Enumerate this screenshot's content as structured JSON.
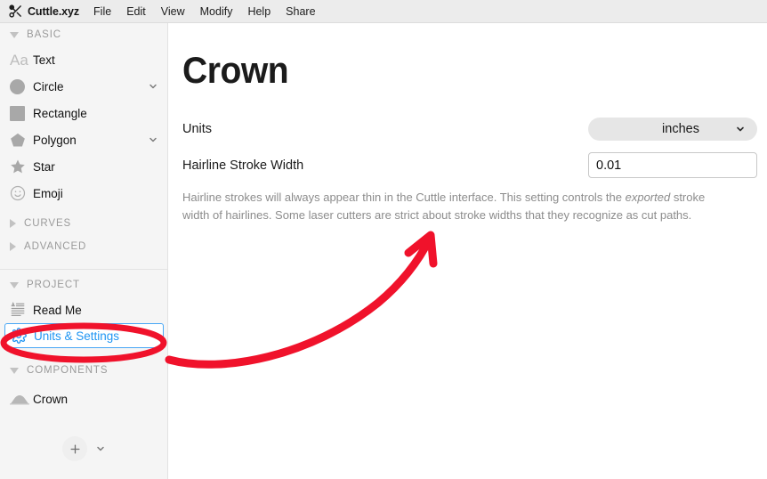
{
  "menubar": {
    "logo_icon": "scissors-icon",
    "app_title": "Cuttle.xyz",
    "items": [
      "File",
      "Edit",
      "View",
      "Modify",
      "Help",
      "Share"
    ]
  },
  "sidebar": {
    "sections": [
      {
        "label": "BASIC",
        "expanded": true,
        "items": [
          {
            "label": "Text",
            "icon": "text-aa-icon",
            "chevron": false,
            "muted": false
          },
          {
            "label": "Circle",
            "icon": "circle-icon",
            "chevron": true,
            "muted": false
          },
          {
            "label": "Rectangle",
            "icon": "rectangle-icon",
            "chevron": false,
            "muted": false
          },
          {
            "label": "Polygon",
            "icon": "pentagon-icon",
            "chevron": true,
            "muted": false
          },
          {
            "label": "Star",
            "icon": "star-icon",
            "chevron": false,
            "muted": false
          },
          {
            "label": "Emoji",
            "icon": "smiley-icon",
            "chevron": false,
            "muted": false
          }
        ]
      },
      {
        "label": "CURVES",
        "expanded": false,
        "items": []
      },
      {
        "label": "ADVANCED",
        "expanded": false,
        "items": []
      },
      {
        "label": "PROJECT",
        "expanded": true,
        "items": [
          {
            "label": "Read Me",
            "icon": "document-icon",
            "chevron": false,
            "selected": false
          },
          {
            "label": "Units & Settings",
            "icon": "gear-icon",
            "chevron": false,
            "selected": true
          }
        ]
      },
      {
        "label": "COMPONENTS",
        "expanded": true,
        "items": [
          {
            "label": "Crown",
            "icon": "crown-shape-icon",
            "chevron": false,
            "selected": false
          }
        ]
      }
    ],
    "footer": {
      "add_label": "+",
      "add_icon": "plus-icon",
      "chevron_icon": "chevron-down-icon"
    },
    "selected_color": "#2196f3"
  },
  "main": {
    "title": "Crown",
    "fields": [
      {
        "label": "Units",
        "control": "select",
        "value": "inches",
        "chevron_icon": "chevron-down-icon"
      },
      {
        "label": "Hairline Stroke Width",
        "control": "input",
        "value": "0.01"
      }
    ],
    "help_text_part1": "Hairline strokes will always appear thin in the Cuttle interface. This setting controls the ",
    "help_text_emphasis": "exported",
    "help_text_part2": " stroke width of hairlines. Some laser cutters are strict about stroke widths that they recognize as cut paths."
  },
  "annotations": {
    "highlight_color": "#f0122b",
    "ellipse_target": "Units & Settings",
    "arrow": "curved-arrow-pointing-up-right"
  }
}
